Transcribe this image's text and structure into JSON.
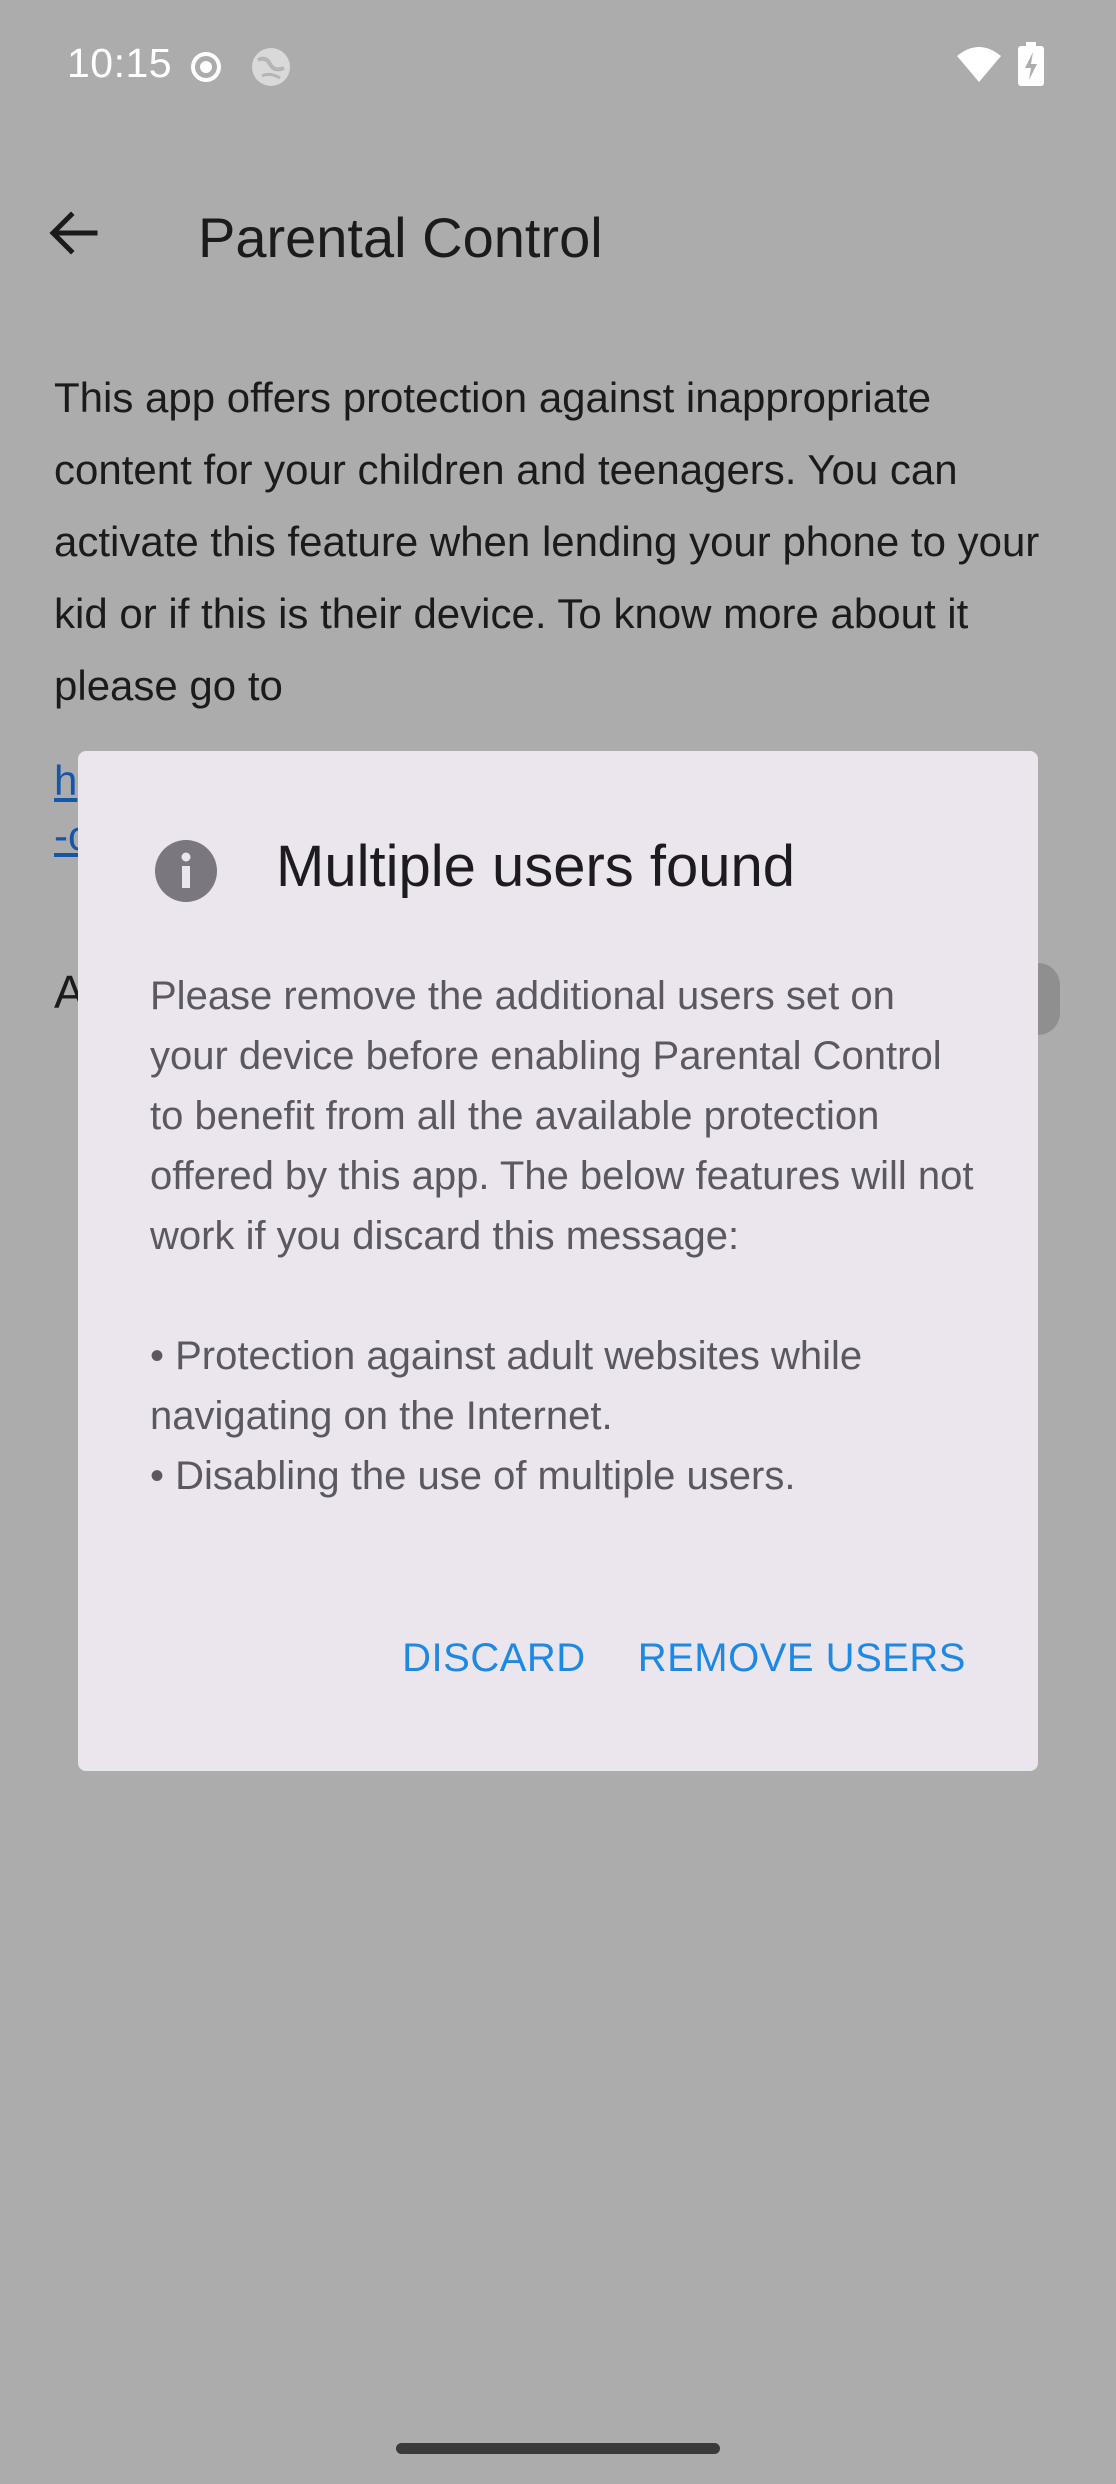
{
  "status_bar": {
    "time": "10:15",
    "icons": [
      "record-icon",
      "globe-icon",
      "wifi-icon",
      "battery-charging-icon"
    ]
  },
  "app_bar": {
    "title": "Parental Control",
    "back_icon": "arrow-back-icon"
  },
  "main": {
    "description": "This app offers protection against inappropriate content for your children and teenagers. You can activate this feature when lending your phone to your kid or if this is their device. To know more about it please go to",
    "link_line1_visible": "h",
    "link_line2_visible": "-c",
    "row_label_visible": "A"
  },
  "dialog": {
    "icon": "info-icon",
    "title": "Multiple users found",
    "body": "Please remove the additional users set on your device before enabling Parental Control to benefit from all the available protection offered by this app. The below features will not work if you discard this message:",
    "bullet1": "• Protection against adult websites while navigating on the Internet.",
    "bullet2": "• Disabling the use of multiple users.",
    "discard_label": "DISCARD",
    "remove_label": "REMOVE USERS",
    "accent_color": "#1e88e5"
  }
}
